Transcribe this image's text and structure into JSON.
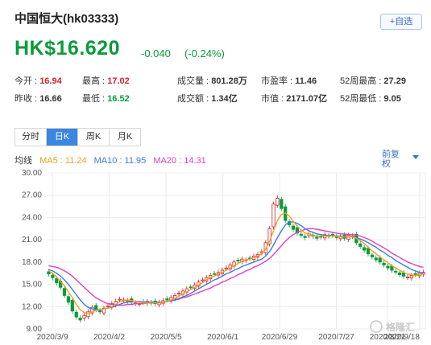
{
  "header": {
    "title": "中国恒大(hk03333)",
    "add_label": "+自选"
  },
  "quote": {
    "price": "HK$16.620",
    "change": "-0.040",
    "change_pct": "(-0.24%)"
  },
  "stats": [
    [
      {
        "label": "今开 :",
        "value": "16.94",
        "color": "up"
      },
      {
        "label": "最高 :",
        "value": "17.02",
        "color": "up"
      },
      {
        "label": "成交量 :",
        "value": "801.28万",
        "color": ""
      },
      {
        "label": "市盈率 :",
        "value": "11.46",
        "color": ""
      },
      {
        "label": "52周最高 :",
        "value": "27.29",
        "color": ""
      }
    ],
    [
      {
        "label": "昨收 :",
        "value": "16.66",
        "color": ""
      },
      {
        "label": "最低 :",
        "value": "16.52",
        "color": "down"
      },
      {
        "label": "成交额 :",
        "value": "1.34亿",
        "color": ""
      },
      {
        "label": "市值 :",
        "value": "2171.07亿",
        "color": ""
      },
      {
        "label": "52周最低 :",
        "value": "9.05",
        "color": ""
      }
    ]
  ],
  "tabs": [
    "分时",
    "日K",
    "周K",
    "月K"
  ],
  "active_tab": 1,
  "ma": {
    "label": "均线",
    "ma5": "MA5 : 11.24",
    "ma10": "MA10 : 11.95",
    "ma20": "MA20 : 14.31"
  },
  "adjust": "前复权",
  "colors": {
    "up": "#d2232a",
    "down": "#0a9b3a",
    "ma5": "#f0a020",
    "ma10": "#3a7be0",
    "ma20": "#e040c0",
    "accent": "#3a86e0"
  },
  "watermark": "格隆汇",
  "chart_data": {
    "type": "candlestick",
    "y_ticks": [
      "30.00",
      "27.00",
      "24.00",
      "21.00",
      "18.00",
      "15.00",
      "12.00",
      "9.00"
    ],
    "ylim": [
      9,
      30
    ],
    "x_ticks": [
      "2020/3/9",
      "2020/4/2",
      "2020/5/5",
      "2020/6/1",
      "2020/6/29",
      "2020/7/27",
      "2020/8/21",
      "2020/9/18"
    ],
    "closes": [
      16.4,
      15.9,
      15.2,
      14.6,
      13.5,
      12.6,
      11.4,
      10.6,
      10.2,
      10.8,
      11.3,
      11.9,
      11.6,
      11.3,
      11.8,
      12.1,
      12.4,
      12.7,
      13.0,
      12.9,
      12.8,
      12.6,
      12.5,
      12.4,
      12.6,
      12.7,
      12.5,
      12.4,
      12.6,
      12.8,
      12.9,
      13.2,
      13.5,
      13.8,
      14.1,
      14.4,
      14.6,
      14.9,
      15.3,
      15.6,
      15.9,
      16.2,
      16.4,
      16.6,
      16.9,
      17.2,
      17.6,
      18.0,
      18.2,
      18.4,
      18.3,
      18.5,
      18.8,
      19.0,
      19.4,
      20.6,
      22.5,
      25.8,
      26.6,
      25.2,
      23.6,
      23.0,
      22.4,
      21.9,
      21.6,
      21.3,
      21.8,
      21.5,
      21.2,
      21.4,
      21.7,
      21.5,
      21.6,
      21.3,
      21.4,
      21.2,
      21.6,
      21.5,
      20.6,
      20.1,
      19.6,
      19.1,
      18.7,
      18.3,
      18.0,
      17.6,
      17.2,
      16.9,
      16.7,
      16.3,
      16.1,
      16.0,
      16.2,
      16.3,
      16.5,
      16.62
    ],
    "ma5": [
      16.8,
      16.5,
      16.0,
      15.4,
      14.8,
      14.0,
      13.2,
      12.3,
      11.6,
      11.2,
      11.1,
      11.3,
      11.5,
      11.6,
      11.7,
      11.8,
      12.0,
      12.3,
      12.6,
      12.8,
      12.9,
      12.8,
      12.7,
      12.6,
      12.5,
      12.5,
      12.5,
      12.5,
      12.5,
      12.6,
      12.7,
      12.9,
      13.1,
      13.4,
      13.7,
      14.0,
      14.3,
      14.6,
      14.9,
      15.2,
      15.6,
      15.9,
      16.1,
      16.4,
      16.6,
      16.9,
      17.2,
      17.5,
      17.8,
      18.1,
      18.3,
      18.4,
      18.6,
      18.8,
      19.1,
      19.7,
      20.8,
      22.2,
      23.6,
      24.4,
      24.6,
      24.2,
      23.5,
      22.8,
      22.3,
      21.9,
      21.8,
      21.6,
      21.5,
      21.5,
      21.5,
      21.5,
      21.5,
      21.5,
      21.4,
      21.4,
      21.4,
      21.4,
      21.2,
      20.9,
      20.5,
      20.0,
      19.5,
      19.1,
      18.7,
      18.3,
      17.9,
      17.5,
      17.2,
      16.9,
      16.6,
      16.4,
      16.3,
      16.2,
      16.3,
      16.4
    ],
    "ma10": [
      17.0,
      16.8,
      16.5,
      16.1,
      15.6,
      15.0,
      14.3,
      13.6,
      12.9,
      12.3,
      11.9,
      11.7,
      11.6,
      11.6,
      11.7,
      11.8,
      11.9,
      12.1,
      12.3,
      12.5,
      12.6,
      12.7,
      12.7,
      12.7,
      12.6,
      12.6,
      12.6,
      12.6,
      12.6,
      12.6,
      12.7,
      12.8,
      12.9,
      13.1,
      13.3,
      13.5,
      13.8,
      14.1,
      14.4,
      14.7,
      15.0,
      15.3,
      15.6,
      15.8,
      16.1,
      16.4,
      16.6,
      16.9,
      17.1,
      17.4,
      17.6,
      17.8,
      18.0,
      18.2,
      18.4,
      18.8,
      19.4,
      20.3,
      21.3,
      22.2,
      23.0,
      23.4,
      23.4,
      23.2,
      22.9,
      22.5,
      22.2,
      22.0,
      21.8,
      21.7,
      21.6,
      21.6,
      21.6,
      21.5,
      21.5,
      21.4,
      21.4,
      21.4,
      21.3,
      21.1,
      20.9,
      20.6,
      20.3,
      20.0,
      19.6,
      19.3,
      18.9,
      18.6,
      18.2,
      17.9,
      17.6,
      17.3,
      17.0,
      16.8,
      16.6,
      16.5
    ],
    "ma20": [
      17.5,
      17.4,
      17.3,
      17.1,
      16.8,
      16.5,
      16.1,
      15.6,
      15.1,
      14.6,
      14.1,
      13.6,
      13.2,
      12.9,
      12.6,
      12.4,
      12.3,
      12.2,
      12.2,
      12.2,
      12.3,
      12.3,
      12.4,
      12.4,
      12.4,
      12.5,
      12.5,
      12.5,
      12.6,
      12.6,
      12.7,
      12.8,
      12.9,
      13.0,
      13.2,
      13.3,
      13.5,
      13.7,
      13.9,
      14.1,
      14.3,
      14.5,
      14.8,
      15.0,
      15.3,
      15.5,
      15.8,
      16.0,
      16.3,
      16.5,
      16.8,
      17.0,
      17.3,
      17.5,
      17.8,
      18.1,
      18.5,
      19.0,
      19.6,
      20.2,
      20.8,
      21.3,
      21.7,
      22.0,
      22.2,
      22.4,
      22.5,
      22.5,
      22.4,
      22.3,
      22.2,
      22.1,
      22.0,
      21.9,
      21.8,
      21.8,
      21.7,
      21.7,
      21.6,
      21.5,
      21.3,
      21.1,
      20.8,
      20.5,
      20.2,
      19.9,
      19.6,
      19.2,
      18.9,
      18.6,
      18.3,
      18.0,
      17.8,
      17.6,
      17.4,
      17.3
    ]
  }
}
